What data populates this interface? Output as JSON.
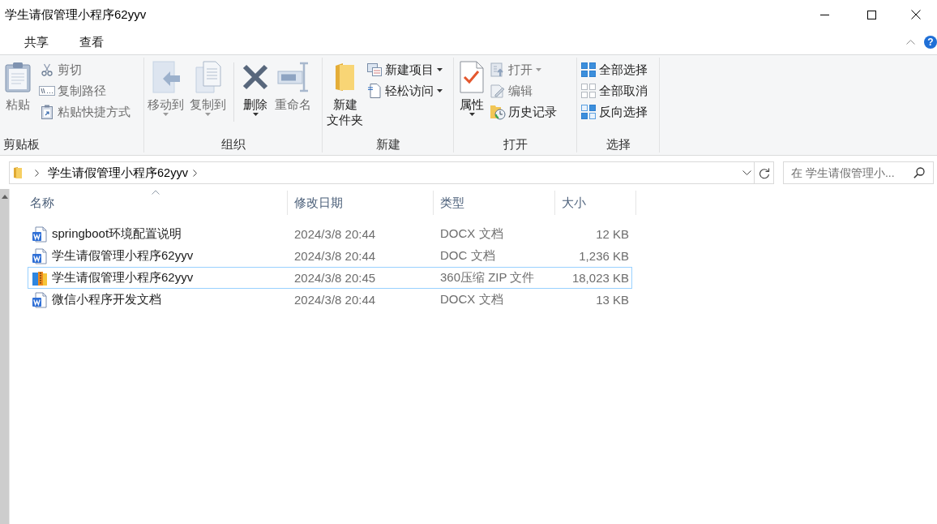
{
  "window": {
    "title": "学生请假管理小程序62yyv"
  },
  "tabs": [
    {
      "label": "共享",
      "selected": false
    },
    {
      "label": "查看",
      "selected": false
    }
  ],
  "help_button": {
    "label": "?"
  },
  "ribbon": {
    "groups": [
      {
        "label": "剪贴板",
        "items": [
          {
            "kind": "large",
            "label": "粘贴",
            "disabled": true,
            "dropdown": false
          },
          {
            "kind": "small",
            "label": "剪切",
            "disabled": true,
            "dropdown": false
          },
          {
            "kind": "small",
            "label": "复制路径",
            "disabled": true,
            "dropdown": false
          },
          {
            "kind": "small",
            "label": "粘贴快捷方式",
            "disabled": true,
            "dropdown": false
          }
        ]
      },
      {
        "label": "组织",
        "items": [
          {
            "kind": "large",
            "label": "移动到",
            "disabled": true,
            "dropdown": true
          },
          {
            "kind": "large",
            "label": "复制到",
            "disabled": true,
            "dropdown": true
          },
          {
            "kind": "large",
            "label": "删除",
            "disabled": false,
            "dropdown": true
          },
          {
            "kind": "large",
            "label": "重命名",
            "disabled": true,
            "dropdown": false
          }
        ]
      },
      {
        "label": "新建",
        "items": [
          {
            "kind": "large",
            "label": [
              "新建",
              "文件夹"
            ],
            "disabled": false,
            "dropdown": false
          },
          {
            "kind": "small",
            "label": "新建项目",
            "disabled": false,
            "dropdown": true
          },
          {
            "kind": "small",
            "label": "轻松访问",
            "disabled": false,
            "dropdown": true
          }
        ]
      },
      {
        "label": "打开",
        "items": [
          {
            "kind": "large",
            "label": "属性",
            "disabled": false,
            "dropdown": true
          },
          {
            "kind": "small",
            "label": "打开",
            "disabled": true,
            "dropdown": true
          },
          {
            "kind": "small",
            "label": "编辑",
            "disabled": true,
            "dropdown": false
          },
          {
            "kind": "small",
            "label": "历史记录",
            "disabled": false,
            "dropdown": false
          }
        ]
      },
      {
        "label": "选择",
        "items": [
          {
            "kind": "small",
            "label": "全部选择",
            "disabled": false,
            "dropdown": false
          },
          {
            "kind": "small",
            "label": "全部取消",
            "disabled": false,
            "dropdown": false
          },
          {
            "kind": "small",
            "label": "反向选择",
            "disabled": false,
            "dropdown": false
          }
        ]
      }
    ]
  },
  "address_bar": {
    "path": [
      "学生请假管理小程序62yyv"
    ]
  },
  "search": {
    "placeholder": "在 学生请假管理小..."
  },
  "table": {
    "columns": [
      {
        "label": "名称",
        "sorted": true
      },
      {
        "label": "修改日期",
        "sorted": false
      },
      {
        "label": "类型",
        "sorted": false
      },
      {
        "label": "大小",
        "sorted": false
      }
    ],
    "rows": [
      {
        "kind": "document",
        "name": "springboot环境配置说明",
        "modified": "2024/3/8 20:44",
        "type": "DOCX 文档",
        "size": "12 KB",
        "focused": false
      },
      {
        "kind": "document",
        "name": "学生请假管理小程序62yyv",
        "modified": "2024/3/8 20:44",
        "type": "DOC 文档",
        "size": "1,236 KB",
        "focused": false
      },
      {
        "kind": "archive",
        "name": "学生请假管理小程序62yyv",
        "modified": "2024/3/8 20:45",
        "type": "360压缩 ZIP 文件",
        "size": "18,023 KB",
        "focused": true
      },
      {
        "kind": "document",
        "name": "微信小程序开发文档",
        "modified": "2024/3/8 20:44",
        "type": "DOCX 文档",
        "size": "13 KB",
        "focused": false
      }
    ]
  }
}
